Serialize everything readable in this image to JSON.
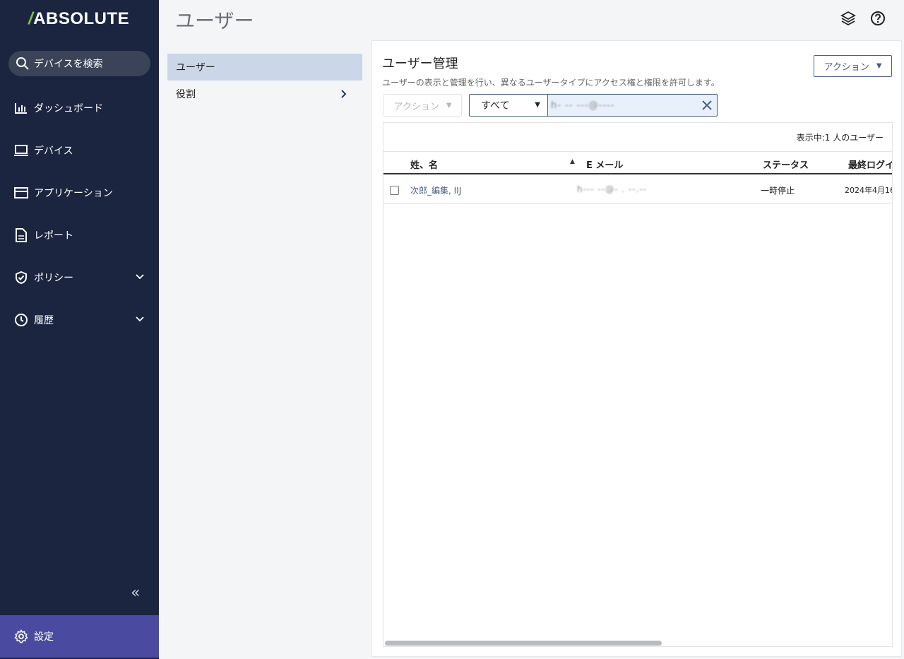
{
  "sidebar": {
    "logo_slash": "/",
    "logo_text": "ABSOLUTE",
    "search_label": "デバイスを検索",
    "items": [
      {
        "label": "ダッシュボード",
        "icon": "chart-icon"
      },
      {
        "label": "デバイス",
        "icon": "laptop-icon"
      },
      {
        "label": "アプリケーション",
        "icon": "window-icon"
      },
      {
        "label": "レポート",
        "icon": "document-icon"
      },
      {
        "label": "ポリシー",
        "icon": "shield-icon"
      },
      {
        "label": "履歴",
        "icon": "clock-icon"
      }
    ],
    "collapse_label": "«",
    "settings_label": "設定"
  },
  "header": {
    "title": "ユーザー"
  },
  "subnav": {
    "items": [
      {
        "label": "ユーザー",
        "active": true
      },
      {
        "label": "役割",
        "active": false
      }
    ]
  },
  "panel": {
    "title": "ユーザー管理",
    "description": "ユーザーの表示と管理を行い、異なるユーザータイプにアクセス権と権限を許可します。",
    "action_top_label": "アクション",
    "action_disabled_label": "アクション",
    "filter_select_value": "すべて",
    "filter_input_value": "h‑ ‑‑ ‑‑‑@‑‑‑‑",
    "count_text": "表示中:1 人のユーザー",
    "columns": [
      "姓、名",
      "E メール",
      "ステータス",
      "最終ログイ"
    ],
    "rows": [
      {
        "name": "次郎_編集, IIJ",
        "email": "h‑‑‑ ‑‑@‑ . ‑‑.‑‑",
        "status": "一時停止",
        "last_login": "2024年4月16"
      }
    ]
  },
  "colors": {
    "sidebar_bg": "#1b2540",
    "settings_bg": "#4a4ba0",
    "accent": "#4a6181",
    "active_subnav": "#cbd7e8"
  }
}
